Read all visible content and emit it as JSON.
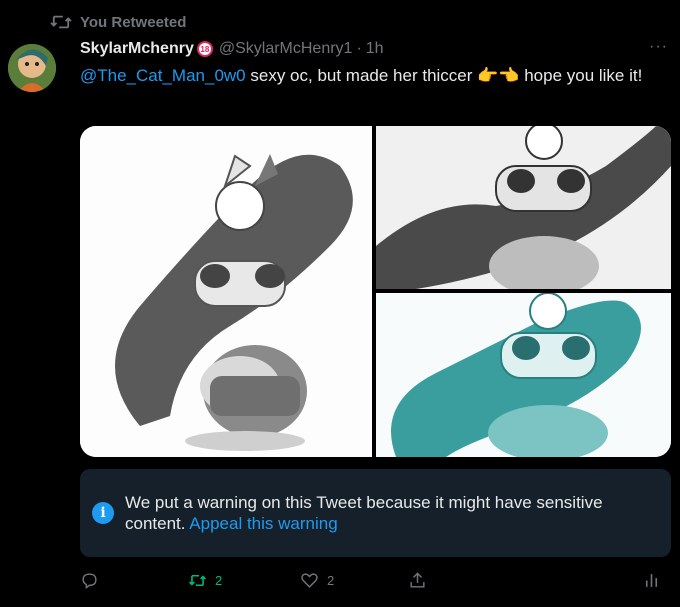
{
  "retweet": {
    "label": "You Retweeted"
  },
  "tweet": {
    "display_name": "SkylarMchenry",
    "badge": "18",
    "handle": "@SkylarMcHenry1",
    "separator": "·",
    "time": "1h",
    "more": "···",
    "mention": "@The_Cat_Man_0w0",
    "text_before_emoji": " sexy oc, but made her thiccer ",
    "emoji": "👉👈",
    "text_after_emoji": " hope you like it!"
  },
  "warning": {
    "icon": "i",
    "message": "We put a warning on this Tweet because it might have sensitive content.",
    "link": "Appeal this warning"
  },
  "actions": {
    "reply_count": "",
    "retweet_count": "2",
    "like_count": "2"
  },
  "colors": {
    "accent": "#1d9bf0",
    "retweet_active": "#00ba7c",
    "muted": "#71767b",
    "warning_bg": "#15202b"
  }
}
